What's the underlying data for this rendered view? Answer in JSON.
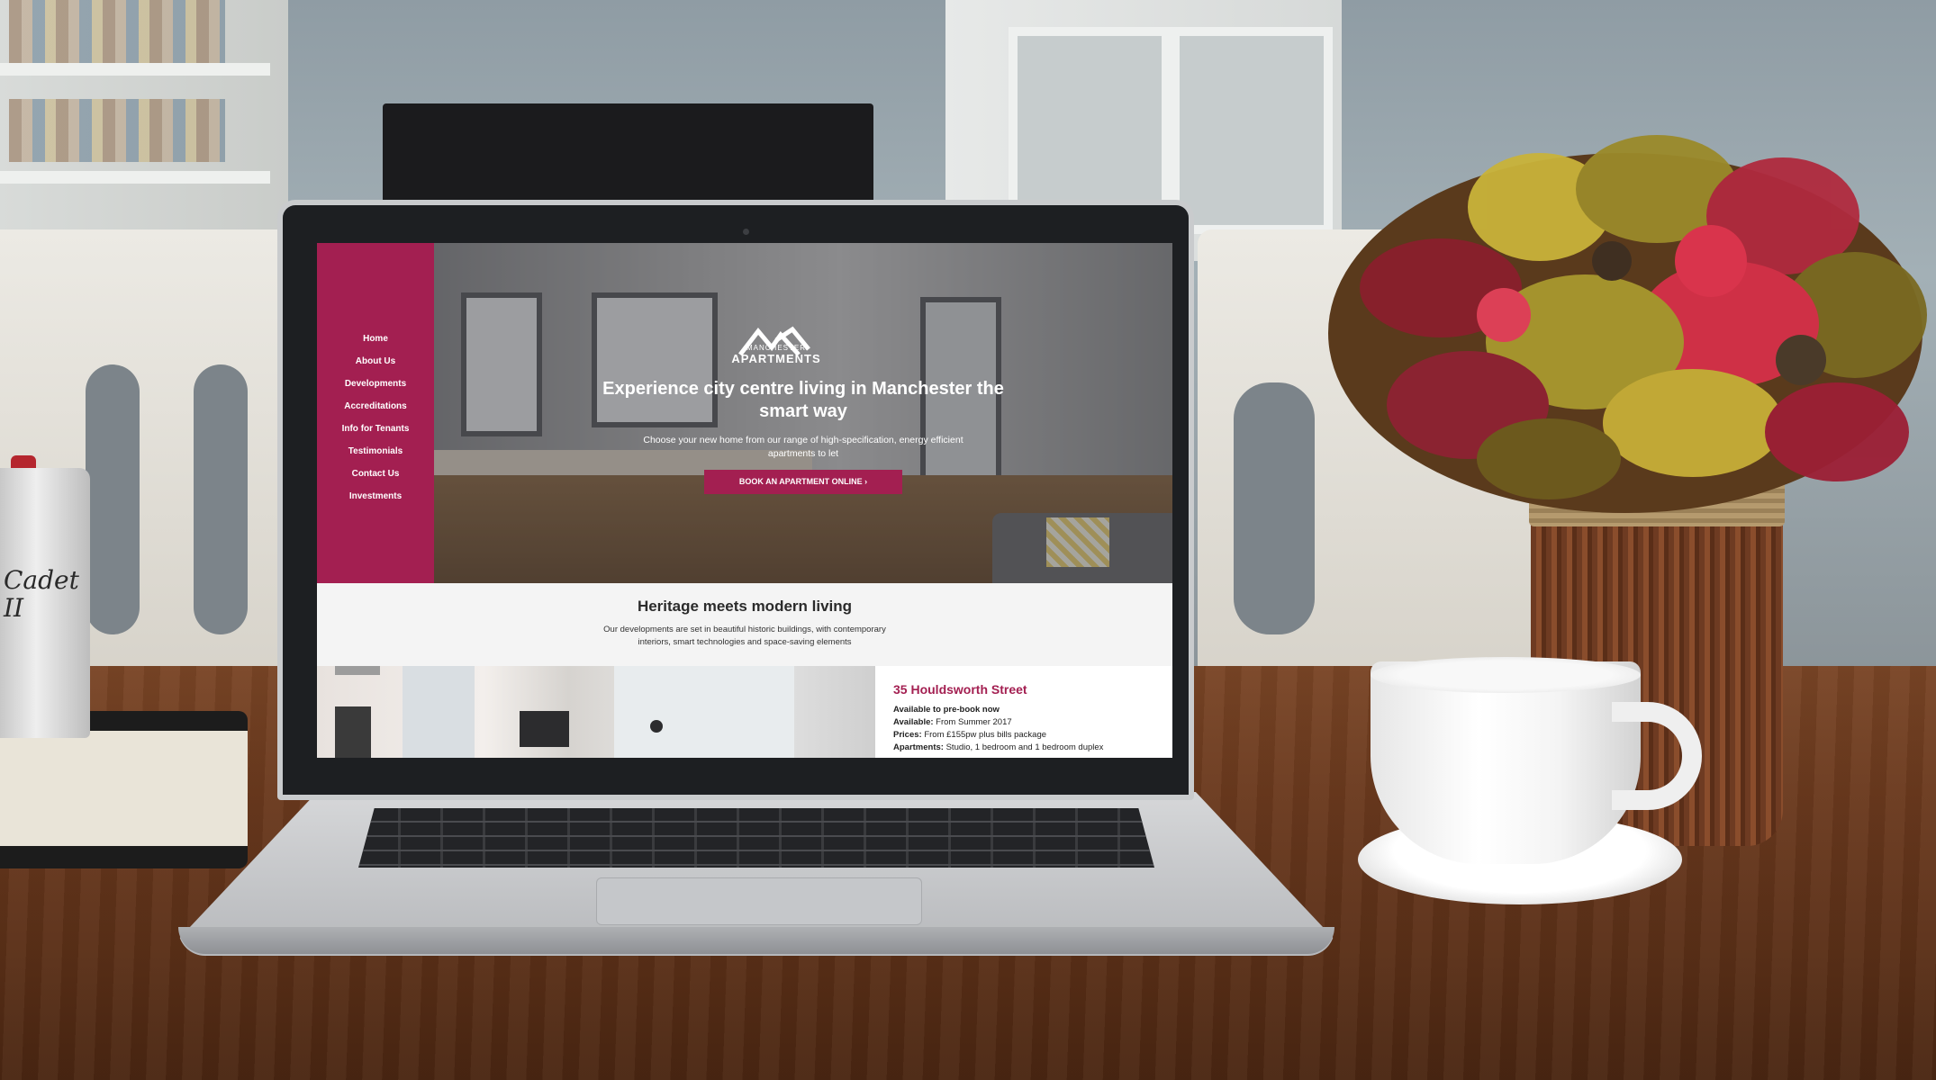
{
  "site": {
    "nav": [
      "Home",
      "About Us",
      "Developments",
      "Accreditations",
      "Info for Tenants",
      "Testimonials",
      "Contact Us",
      "Investments"
    ],
    "logo": {
      "top_line": "MANCHESTER",
      "bottom_line": "APARTMENTS"
    },
    "hero": {
      "title": "Experience city centre living in Manchester the smart way",
      "subtitle": "Choose your new home from our range of high-specification, energy efficient apartments to let",
      "cta_label": "BOOK AN APARTMENT ONLINE ›"
    },
    "section": {
      "title": "Heritage meets modern living",
      "description": "Our developments are set in beautiful historic buildings, with contemporary interiors, smart technologies and space-saving elements"
    },
    "development": {
      "title": "35 Houldsworth Street",
      "status": "Available to pre-book now",
      "available_label": "Available:",
      "available_value": "From Summer 2017",
      "prices_label": "Prices:",
      "prices_value": "From £155pw plus bills package",
      "apartments_label": "Apartments:",
      "apartments_value": "Studio, 1 bedroom and 1 bedroom duplex"
    }
  },
  "scene": {
    "camera_label": "Cadet II"
  },
  "colors": {
    "brand": "#a31f51",
    "sidebar": "#a31f51",
    "text_dark": "#2b2b2b"
  }
}
